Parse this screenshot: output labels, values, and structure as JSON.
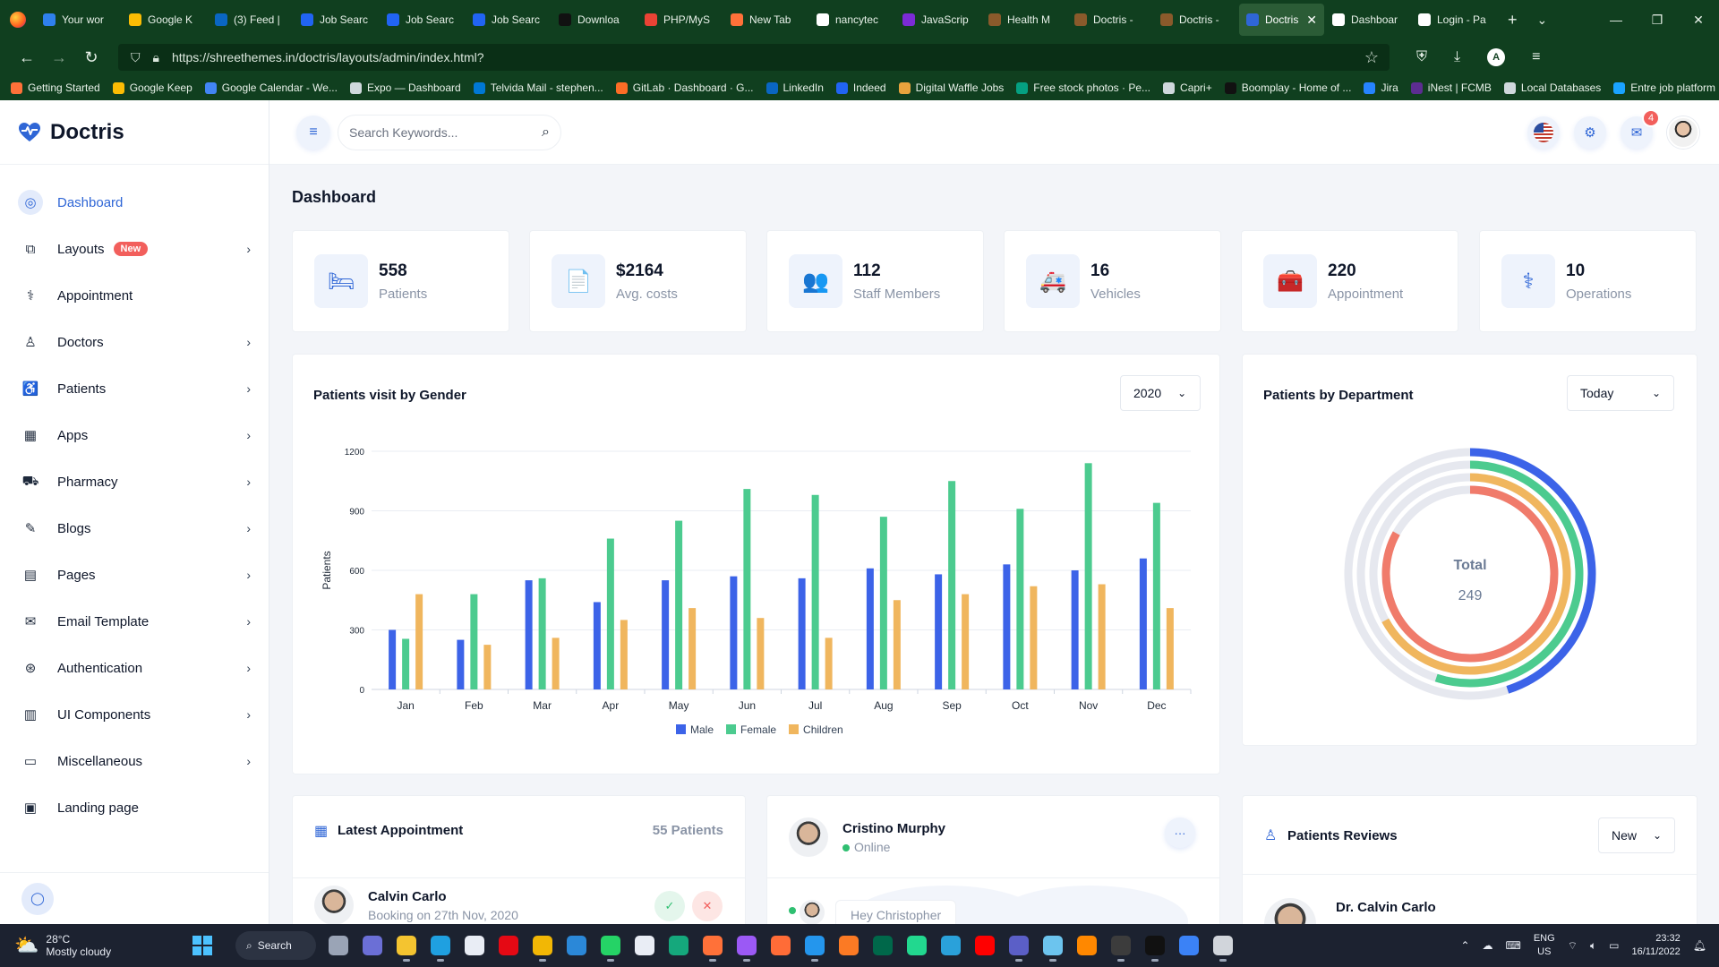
{
  "browser": {
    "tabs": [
      {
        "label": "Your wor",
        "color": "#2f80ed"
      },
      {
        "label": "Google K",
        "color": "#fbbc04"
      },
      {
        "label": "(3) Feed |",
        "color": "#0a66c2"
      },
      {
        "label": "Job Searc",
        "color": "#2164f3"
      },
      {
        "label": "Job Searc",
        "color": "#2164f3"
      },
      {
        "label": "Job Searc",
        "color": "#2164f3"
      },
      {
        "label": "Downloa",
        "color": "#111111"
      },
      {
        "label": "PHP/MyS",
        "color": "#ea4335"
      },
      {
        "label": "New Tab",
        "color": "#ff7139"
      },
      {
        "label": "nancytec",
        "color": "#ffffff"
      },
      {
        "label": "JavaScrip",
        "color": "#7b2bd6"
      },
      {
        "label": "Health M",
        "color": "#8a5a2b"
      },
      {
        "label": "Doctris - ",
        "color": "#8a5a2b"
      },
      {
        "label": "Doctris - ",
        "color": "#8a5a2b"
      },
      {
        "label": "Doctris",
        "color": "#2f66d6",
        "active": true
      },
      {
        "label": "Dashboar",
        "color": "#ffffff"
      },
      {
        "label": "Login - Pa",
        "color": "#ffffff"
      }
    ],
    "url": "https://shreethemes.in/doctris/layouts/admin/index.html?",
    "bookmarks": [
      {
        "label": "Getting Started",
        "color": "#ff7139"
      },
      {
        "label": "Google Keep",
        "color": "#fbbc04"
      },
      {
        "label": "Google Calendar - We...",
        "color": "#4285f4"
      },
      {
        "label": "Expo — Dashboard",
        "color": "#cfd8dc"
      },
      {
        "label": "Telvida Mail - stephen...",
        "color": "#0078d4"
      },
      {
        "label": "GitLab · Dashboard · G...",
        "color": "#fc6d26"
      },
      {
        "label": "LinkedIn",
        "color": "#0a66c2"
      },
      {
        "label": "Indeed",
        "color": "#2164f3"
      },
      {
        "label": "Digital Waffle Jobs",
        "color": "#e8a33d"
      },
      {
        "label": "Free stock photos · Pe...",
        "color": "#05a081"
      },
      {
        "label": "Capri+",
        "color": "#cfd8dc"
      },
      {
        "label": "Boomplay - Home of ...",
        "color": "#111111"
      },
      {
        "label": "Jira",
        "color": "#2684ff"
      },
      {
        "label": "iNest | FCMB",
        "color": "#5c2d91"
      },
      {
        "label": "Local Databases",
        "color": "#cfd8dc"
      },
      {
        "label": "Entre job platform",
        "color": "#1aa3ff"
      }
    ]
  },
  "brand": {
    "name": "Doctris",
    "accent": "#2f66d6"
  },
  "sidebar": {
    "items": [
      {
        "label": "Dashboard",
        "icon": "dashboard-icon",
        "glyph": "◎",
        "active": true
      },
      {
        "label": "Layouts",
        "icon": "layouts-icon",
        "glyph": "⧉",
        "badge": "New",
        "chevron": true
      },
      {
        "label": "Appointment",
        "icon": "stethoscope-icon",
        "glyph": "⚕"
      },
      {
        "label": "Doctors",
        "icon": "user-icon",
        "glyph": "♙",
        "chevron": true
      },
      {
        "label": "Patients",
        "icon": "wheelchair-icon",
        "glyph": "♿",
        "chevron": true
      },
      {
        "label": "Apps",
        "icon": "apps-grid-icon",
        "glyph": "▦",
        "chevron": true
      },
      {
        "label": "Pharmacy",
        "icon": "cart-icon",
        "glyph": "⛟",
        "chevron": true
      },
      {
        "label": "Blogs",
        "icon": "blog-icon",
        "glyph": "✎",
        "chevron": true
      },
      {
        "label": "Pages",
        "icon": "pages-icon",
        "glyph": "▤",
        "chevron": true
      },
      {
        "label": "Email Template",
        "icon": "mail-open-icon",
        "glyph": "✉",
        "chevron": true
      },
      {
        "label": "Authentication",
        "icon": "login-icon",
        "glyph": "⊛",
        "chevron": true
      },
      {
        "label": "UI Components",
        "icon": "file-icon",
        "glyph": "▥",
        "chevron": true
      },
      {
        "label": "Miscellaneous",
        "icon": "misc-icon",
        "glyph": "▭",
        "chevron": true
      },
      {
        "label": "Landing page",
        "icon": "browser-icon",
        "glyph": "▣"
      }
    ]
  },
  "search": {
    "placeholder": "Search Keywords..."
  },
  "topbar": {
    "notifications": "4"
  },
  "page": {
    "title": "Dashboard"
  },
  "stats": [
    {
      "value": "558",
      "label": "Patients",
      "icon": "bed-icon",
      "glyph": "🛏"
    },
    {
      "value": "$2164",
      "label": "Avg. costs",
      "icon": "file-chart-icon",
      "glyph": "📄"
    },
    {
      "value": "112",
      "label": "Staff Members",
      "icon": "users-icon",
      "glyph": "👥"
    },
    {
      "value": "16",
      "label": "Vehicles",
      "icon": "ambulance-icon",
      "glyph": "🚑"
    },
    {
      "value": "220",
      "label": "Appointment",
      "icon": "first-aid-kit-icon",
      "glyph": "🧰"
    },
    {
      "value": "10",
      "label": "Operations",
      "icon": "operations-icon",
      "glyph": "⚕"
    }
  ],
  "gender_card": {
    "title": "Patients visit by Gender",
    "year": "2020"
  },
  "dept_card": {
    "title": "Patients by Department",
    "period": "Today",
    "total_label": "Total",
    "total_value": "249"
  },
  "appointment_card": {
    "title": "Latest Appointment",
    "count": "55 Patients",
    "name": "Calvin Carlo",
    "sub": "Booking on 27th Nov, 2020"
  },
  "chat_card": {
    "name": "Cristino Murphy",
    "status": "Online",
    "message": "Hey Christopher"
  },
  "reviews_card": {
    "title": "Patients Reviews",
    "filter": "New",
    "name": "Dr. Calvin Carlo"
  },
  "chart_data": [
    {
      "type": "bar",
      "title": "Patients visit by Gender",
      "xlabel": "",
      "ylabel": "Patients",
      "categories": [
        "Jan",
        "Feb",
        "Mar",
        "Apr",
        "May",
        "Jun",
        "Jul",
        "Aug",
        "Sep",
        "Oct",
        "Nov",
        "Dec"
      ],
      "ylim": [
        0,
        1200
      ],
      "yticks": [
        0,
        300,
        600,
        900,
        1200
      ],
      "grid": true,
      "legend": "bottom-center",
      "series": [
        {
          "name": "Male",
          "color": "#3c63e8",
          "values": [
            300,
            250,
            550,
            440,
            550,
            570,
            560,
            610,
            580,
            630,
            600,
            660
          ]
        },
        {
          "name": "Female",
          "color": "#4ccb8f",
          "values": [
            255,
            480,
            560,
            760,
            850,
            1010,
            980,
            870,
            1050,
            910,
            1140,
            940
          ]
        },
        {
          "name": "Children",
          "color": "#f0b65e",
          "values": [
            480,
            225,
            260,
            350,
            410,
            360,
            260,
            450,
            480,
            520,
            530,
            410
          ]
        }
      ]
    },
    {
      "type": "radialBar",
      "title": "Patients by Department",
      "total": 249,
      "series": [
        {
          "color": "#3c63e8",
          "value": 45
        },
        {
          "color": "#4ccb8f",
          "value": 55
        },
        {
          "color": "#f0b65e",
          "value": 67
        },
        {
          "color": "#f07b6b",
          "value": 83
        }
      ]
    }
  ],
  "taskbar": {
    "weather_temp": "28°C",
    "weather_desc": "Mostly cloudy",
    "search_label": "Search",
    "lang_top": "ENG",
    "lang_bottom": "US",
    "time": "23:32",
    "date": "16/11/2022",
    "apps": [
      {
        "name": "task-view-icon",
        "color": "#9aa4b6"
      },
      {
        "name": "teams-chat-icon",
        "color": "#6b6fd6"
      },
      {
        "name": "file-explorer-icon",
        "color": "#f4c430",
        "run": true
      },
      {
        "name": "edge-icon",
        "color": "#1fa0e0",
        "run": true
      },
      {
        "name": "store-icon",
        "color": "#e9edf5"
      },
      {
        "name": "netflix-icon",
        "color": "#e50914"
      },
      {
        "name": "chrome-icon",
        "color": "#f2b705",
        "run": true
      },
      {
        "name": "snipping-tool-icon",
        "color": "#2b88d8"
      },
      {
        "name": "whatsapp-icon",
        "color": "#25d366",
        "run": true
      },
      {
        "name": "slack-icon",
        "color": "#e9edf5"
      },
      {
        "name": "git-icon",
        "color": "#15a87c"
      },
      {
        "name": "firefox-icon",
        "color": "#ff7139",
        "run": true
      },
      {
        "name": "phpstorm-icon",
        "color": "#9b59f5",
        "run": true
      },
      {
        "name": "postman-icon",
        "color": "#ff6c37"
      },
      {
        "name": "docker-icon",
        "color": "#2496ed",
        "run": true
      },
      {
        "name": "xampp-icon",
        "color": "#fb7a24"
      },
      {
        "name": "mongodb-icon",
        "color": "#00684a"
      },
      {
        "name": "datagrip-icon",
        "color": "#22d88f"
      },
      {
        "name": "telegram-icon",
        "color": "#2aa1da"
      },
      {
        "name": "youtube-icon",
        "color": "#ff0000"
      },
      {
        "name": "teams-icon",
        "color": "#5b5fc7",
        "run": true
      },
      {
        "name": "notepad-icon",
        "color": "#6cc4ee",
        "run": true
      },
      {
        "name": "vlc-icon",
        "color": "#ff8800"
      },
      {
        "name": "terminal-icon",
        "color": "#3c3c3c",
        "run": true
      },
      {
        "name": "cmd-icon",
        "color": "#111111",
        "run": true
      },
      {
        "name": "photos-icon",
        "color": "#3b82f6"
      },
      {
        "name": "widgets-icon",
        "color": "#d1d5db",
        "run": true
      }
    ]
  }
}
